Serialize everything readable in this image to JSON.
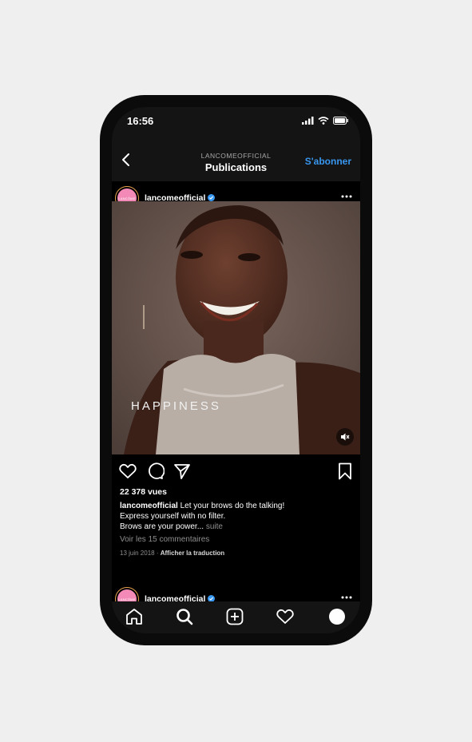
{
  "status": {
    "time": "16:56"
  },
  "nav": {
    "account": "LANCOMEOFFICIAL",
    "title": "Publications",
    "follow_label": "S'abonner"
  },
  "post": {
    "username": "lancomeofficial",
    "avatar_text": "LANCÔME",
    "media_text": "HAPPINESS",
    "views": "22 378 vues",
    "caption_user": "lancomeofficial",
    "caption_line1": "Let your brows do the talking!",
    "caption_line2": "Express yourself with no filter.",
    "caption_line3": "Brows are your power...",
    "more_label": "suite",
    "comments_label": "Voir les 15 commentaires",
    "date": "13 juin 2018",
    "separator": "·",
    "translate_label": "Afficher la traduction"
  },
  "next_post": {
    "username": "lancomeofficial",
    "avatar_text": "LANCÔME"
  },
  "icons": {
    "back": "chevron-left-icon",
    "more": "more-horizontal-icon",
    "like": "heart-icon",
    "comment": "comment-icon",
    "share": "send-icon",
    "save": "bookmark-icon",
    "mute": "muted-speaker-icon",
    "home": "home-icon",
    "search": "search-icon",
    "add": "add-post-icon",
    "activity": "heart-icon",
    "profile": "profile-avatar-icon"
  },
  "colors": {
    "accent": "#3897f0",
    "background": "#000000",
    "avatar_pink": "#f389b6"
  }
}
